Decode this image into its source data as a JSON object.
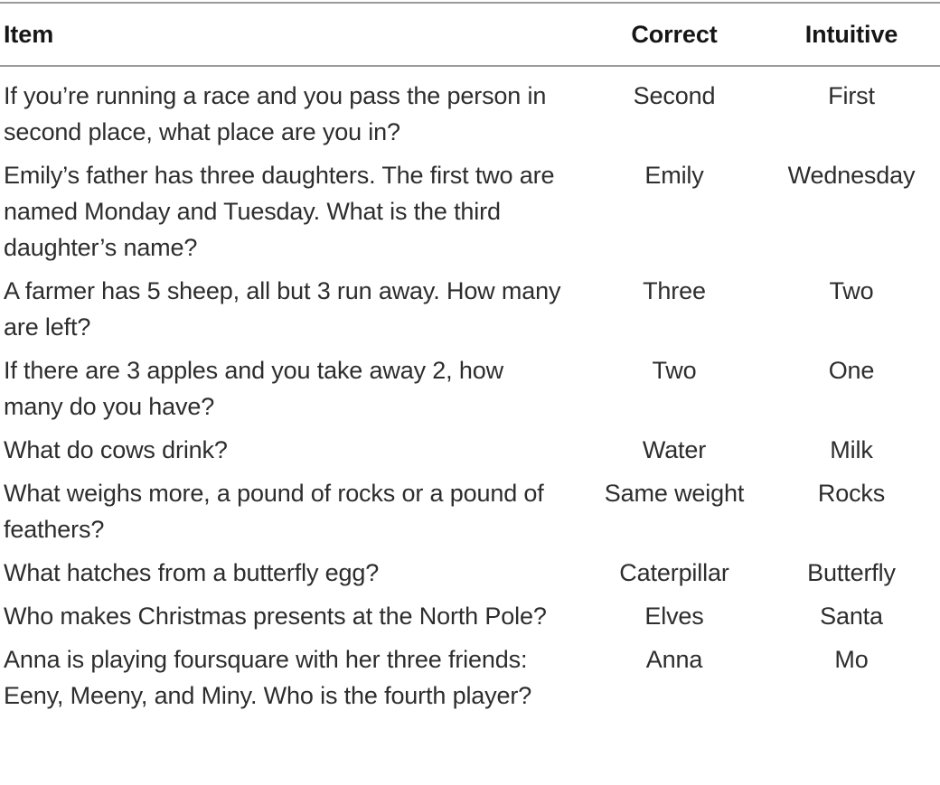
{
  "table": {
    "columns": [
      {
        "key": "item",
        "label": "Item"
      },
      {
        "key": "correct",
        "label": "Correct"
      },
      {
        "key": "intuitive",
        "label": "Intuitive"
      }
    ],
    "rows": [
      {
        "item": "If you’re running a race and you pass the person in second place, what place are you in?",
        "correct": "Second",
        "intuitive": "First"
      },
      {
        "item": "Emily’s father has three daughters. The first two are named Monday and Tuesday. What is the third daughter’s name?",
        "correct": "Emily",
        "intuitive": "Wednesday"
      },
      {
        "item": "A farmer has 5 sheep, all but 3 run away. How many are left?",
        "correct": "Three",
        "intuitive": "Two"
      },
      {
        "item": "If there are 3 apples and you take away 2, how many do you have?",
        "correct": "Two",
        "intuitive": "One"
      },
      {
        "item": "What do cows drink?",
        "correct": "Water",
        "intuitive": "Milk"
      },
      {
        "item": "What weighs more, a pound of rocks or a pound of feathers?",
        "correct": "Same weight",
        "intuitive": "Rocks"
      },
      {
        "item": "What hatches from a butterfly egg?",
        "correct": "Caterpillar",
        "intuitive": "Butterfly"
      },
      {
        "item": "Who makes Christmas presents at the North Pole?",
        "correct": "Elves",
        "intuitive": "Santa"
      },
      {
        "item": "Anna is playing foursquare with her three friends: Eeny, Meeny, and Miny. Who is the fourth player?",
        "correct": "Anna",
        "intuitive": "Mo"
      }
    ]
  },
  "style": {
    "rule_color": "#9b9b9b",
    "header_text_color": "#161616",
    "body_text_color": "#2d2d2d",
    "background_color": "#ffffff"
  }
}
